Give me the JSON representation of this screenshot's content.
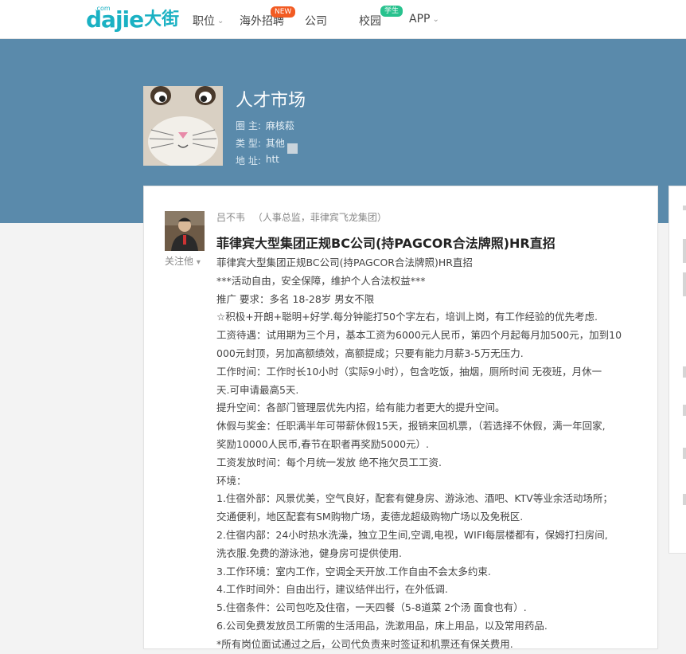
{
  "nav": {
    "logo_latin": "dajie",
    "logo_cn": "大街",
    "logo_sup": ".com",
    "items": [
      {
        "label": "职位",
        "has_dropdown": true
      },
      {
        "label": "海外招聘",
        "badge": "NEW"
      },
      {
        "label": "公司"
      },
      {
        "label": "校园",
        "badge": "学生"
      },
      {
        "label": "APP",
        "has_dropdown": true
      }
    ]
  },
  "group": {
    "title": "人才市场",
    "owner_label": "圈 主:",
    "owner": "麻核菘",
    "type_label": "类 型:",
    "type": "其他",
    "address_label": "地 址:",
    "address": "htt"
  },
  "post": {
    "author": "吕不韦",
    "author_title": "（人事总监，菲律宾飞龙集团）",
    "follow_label": "关注他",
    "title": "菲律宾大型集团正规BC公司(持PAGCOR合法牌照)HR直招",
    "lines": [
      "菲律宾大型集团正规BC公司(持PAGCOR合法牌照)HR直招",
      "***活动自由，安全保障，维护个人合法权益***",
      "推广  要求：多名  18-28岁  男女不限",
      "☆积极+开朗+聪明+好学.每分钟能打50个字左右，培训上岗，有工作经验的优先考虑.",
      "工资待遇：试用期为三个月，基本工资为6000元人民币，第四个月起每月加500元，加到10",
      "000元封顶，另加高额绩效，高额提成；只要有能力月薪3-5万无压力.",
      "工作时间：工作时长10小时（实际9小时），包含吃饭，抽烟，厕所时间  无夜班，月休一",
      "天.可申请最高5天.",
      "提升空间：各部门管理层优先内招，给有能力者更大的提升空间。",
      "休假与奖金：任职满半年可带薪休假15天，报销来回机票，（若选择不休假，满一年回家,",
      "奖励10000人民币,春节在职者再奖励5000元）.",
      "工资发放时间：每个月统一发放  绝不拖欠员工工资.",
      "环境：",
      "1.住宿外部：风景优美，空气良好，配套有健身房、游泳池、酒吧、KTV等业余活动场所；",
      "交通便利，地区配套有SM购物广场，麦德龙超级购物广场以及免税区.",
      "2.住宿内部：24小时热水洗澡，独立卫生间,空调,电视，WIFI每层楼都有，保姆打扫房间,",
      "洗衣服.免费的游泳池，健身房可提供使用.",
      "3.工作环境：室内工作，空调全天开放.工作自由不会太多约束.",
      "4.工作时间外：自由出行，建议结伴出行，在外低调.",
      "5.住宿条件：公司包吃及住宿，一天四餐（5-8道菜  2个汤  面食也有）.",
      "6.公司免费发放员工所需的生活用品，洗漱用品，床上用品，以及常用药品.",
      "*所有岗位面试通过之后，公司代负责来时签证和机票还有保关费用."
    ]
  },
  "colors": {
    "brand": "#1ab1c3",
    "banner": "#5a8aab",
    "badge_new": "#f25b23",
    "badge_student": "#28c28e"
  }
}
